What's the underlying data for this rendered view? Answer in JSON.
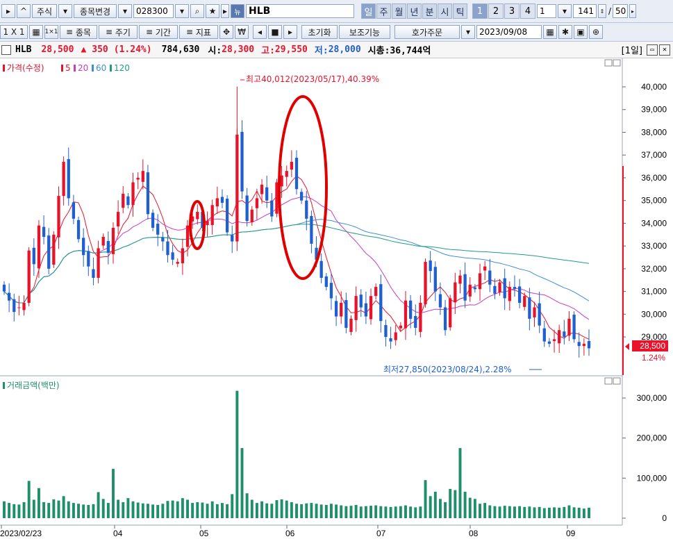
{
  "toolbar": {
    "market": "주식",
    "change_stock": "종목변경",
    "code": "028300",
    "name_badge": "뉴",
    "stock_name": "HLB",
    "periods": [
      "일",
      "주",
      "월",
      "년",
      "분",
      "시",
      "틱"
    ],
    "active_period": "일",
    "numbers": [
      "1",
      "2",
      "3",
      "4"
    ],
    "active_number": "1",
    "count_dropdown": "1",
    "count_value": "141",
    "total_sep": "/",
    "total": "50",
    "layout": "1 X 1",
    "menu_items": [
      "종목",
      "주기",
      "기간",
      "지표"
    ],
    "won_icon": "₩",
    "reset": "초기화",
    "aux": "보조기능",
    "order": "호가주문",
    "date": "2023/09/08"
  },
  "info": {
    "name": "HLB",
    "price": "28,500",
    "change_arrow": "▲",
    "change": "350",
    "change_pct": "(1.24%)",
    "volume": "784,630",
    "open_label": "시:",
    "open": "28,300",
    "high_label": "고:",
    "high": "29,550",
    "low_label": "저:",
    "low": "28,000",
    "cap_label": "시총:",
    "cap": "36,744억",
    "period_tag": "[1일]"
  },
  "colors": {
    "up": "#e8132a",
    "down": "#1f5fd1",
    "ma5": "#e8132a",
    "ma20": "#c53ec5",
    "ma60": "#3c8fd6",
    "ma120": "#1e9c86",
    "volume": "#1e8f6a",
    "highlight": "#e00000"
  },
  "chart_data": [
    {
      "type": "candlestick",
      "title": "가격(수정)",
      "legend": [
        {
          "name": "가격(수정)"
        },
        {
          "name": "5"
        },
        {
          "name": "20"
        },
        {
          "name": "60"
        },
        {
          "name": "120"
        }
      ],
      "ylim": [
        28000,
        40000
      ],
      "yticks": [
        29000,
        30000,
        31000,
        32000,
        33000,
        34000,
        35000,
        36000,
        37000,
        38000,
        39000,
        40000
      ],
      "ytick_labels": [
        "29,000",
        "30,000",
        "31,000",
        "32,000",
        "33,000",
        "34,000",
        "35,000",
        "36,000",
        "37,000",
        "38,000",
        "39,000",
        "40,000"
      ],
      "xtick_labels": [
        "2023/02/23",
        "04",
        "05",
        "06",
        "07",
        "08",
        "09"
      ],
      "current_price": {
        "label": "28,500",
        "pct": "1.24%",
        "value": 28500
      },
      "annotations": [
        {
          "text": "최고40,012(2023/05/17),40.39%",
          "value": 40012
        },
        {
          "text": "최저27,850(2023/08/24),2.28%",
          "value": 27850
        }
      ],
      "close": [
        31000,
        30600,
        30100,
        30300,
        30500,
        32800,
        32200,
        33900,
        33400,
        32000,
        33500,
        35200,
        36700,
        35100,
        34200,
        33300,
        32600,
        32100,
        31600,
        32900,
        33400,
        32700,
        33800,
        34500,
        35300,
        34800,
        35800,
        36000,
        36300,
        34400,
        33800,
        33500,
        33200,
        32600,
        32400,
        32300,
        32900,
        33900,
        34300,
        34500,
        33800,
        34100,
        34800,
        35100,
        34900,
        33600,
        33200,
        37900,
        35400,
        34100,
        34600,
        35100,
        35700,
        35000,
        34300,
        35800,
        36100,
        36300,
        36700,
        35500,
        35000,
        34200,
        33100,
        32400,
        31600,
        31200,
        30700,
        29900,
        30500,
        29400,
        29800,
        30800,
        30300,
        29900,
        30800,
        31200,
        29700,
        29000,
        28800,
        29200,
        29500,
        30600,
        29800,
        29400,
        30500,
        32300,
        31900,
        31000,
        30300,
        29300,
        30700,
        31400,
        31700,
        30600,
        31300,
        31100,
        31800,
        32100,
        31300,
        30900,
        31400,
        30700,
        31200,
        31100,
        30500,
        30800,
        29800,
        30300,
        29500,
        28800,
        28700,
        28900,
        29300,
        29000,
        29800,
        28900,
        28600,
        28700,
        28500
      ],
      "ma_note": "MA5/MA20/MA60/MA120 computed from close series"
    },
    {
      "type": "bar",
      "title": "거래금액(백만)",
      "ylim": [
        0,
        340000
      ],
      "yticks": [
        0,
        100000,
        200000,
        300000
      ],
      "ytick_labels": [
        "0",
        "100,000",
        "200,000",
        "300,000"
      ],
      "values": [
        42,
        38,
        35,
        34,
        40,
        93,
        46,
        75,
        40,
        38,
        47,
        44,
        55,
        42,
        38,
        36,
        34,
        33,
        35,
        65,
        48,
        38,
        123,
        46,
        40,
        50,
        42,
        39,
        37,
        36,
        34,
        33,
        36,
        43,
        44,
        42,
        50,
        46,
        38,
        40,
        39,
        36,
        42,
        35,
        38,
        35,
        60,
        318,
        175,
        62,
        46,
        38,
        42,
        37,
        36,
        45,
        47,
        44,
        40,
        36,
        35,
        37,
        38,
        36,
        34,
        33,
        36,
        34,
        32,
        30,
        31,
        33,
        29,
        30,
        31,
        32,
        30,
        29,
        28,
        29,
        30,
        32,
        29,
        27,
        29,
        95,
        55,
        66,
        48,
        40,
        73,
        70,
        175,
        66,
        51,
        48,
        36,
        38,
        32,
        30,
        29,
        31,
        30,
        29,
        30,
        28,
        29,
        27,
        28,
        25,
        26,
        27,
        26,
        28,
        32,
        27,
        26,
        24,
        26
      ]
    }
  ]
}
